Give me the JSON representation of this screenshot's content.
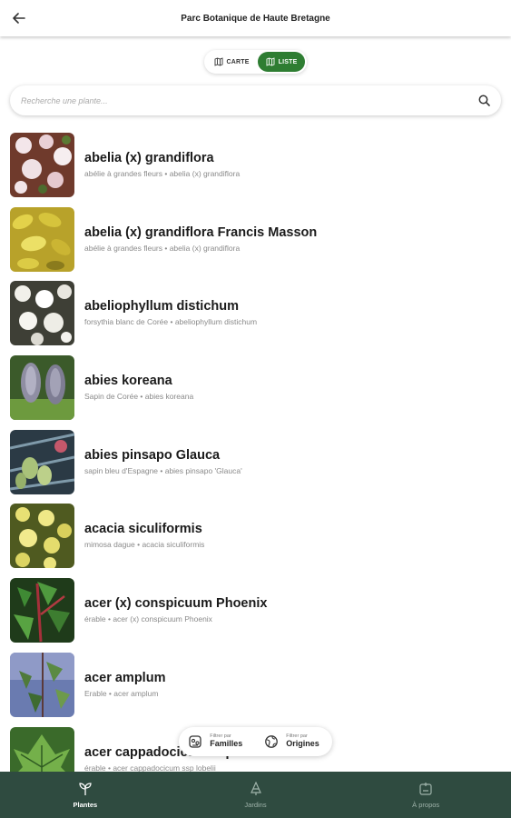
{
  "appbar": {
    "title": "Parc Botanique de Haute Bretagne",
    "back_icon": "arrow-left-icon"
  },
  "view_toggle": {
    "options": [
      {
        "label": "CARTE",
        "icon": "map-icon",
        "active": false
      },
      {
        "label": "LISTE",
        "icon": "list-icon",
        "active": true
      }
    ]
  },
  "search": {
    "placeholder": "Recherche une plante...",
    "value": "",
    "icon": "search-icon"
  },
  "plants": [
    {
      "name": "abelia (x) grandiflora",
      "subtitle": "abélie à grandes fleurs • abelia (x) grandiflora"
    },
    {
      "name": "abelia (x) grandiflora Francis Masson",
      "subtitle": "abélie à grandes fleurs • abelia (x) grandiflora"
    },
    {
      "name": "abeliophyllum distichum",
      "subtitle": "forsythia blanc de Corée • abeliophyllum distichum"
    },
    {
      "name": "abies koreana",
      "subtitle": "Sapin de Corée • abies koreana"
    },
    {
      "name": "abies pinsapo Glauca",
      "subtitle": "sapin bleu d'Espagne • abies pinsapo 'Glauca'"
    },
    {
      "name": "acacia siculiformis",
      "subtitle": "mimosa dague • acacia siculiformis"
    },
    {
      "name": "acer (x) conspicuum Phoenix",
      "subtitle": "érable • acer (x) conspicuum Phoenix"
    },
    {
      "name": "acer amplum",
      "subtitle": "Erable • acer amplum"
    },
    {
      "name": "acer cappadocicum ssp lobelii",
      "subtitle": "érable • acer cappadocicum ssp lobelii"
    }
  ],
  "filters": [
    {
      "small": "Filtrer par",
      "label": "Familles",
      "icon": "families-icon"
    },
    {
      "small": "Filtrer par",
      "label": "Origines",
      "icon": "globe-icon"
    }
  ],
  "bottom_nav": [
    {
      "label": "Plantes",
      "icon": "plant-icon",
      "active": true
    },
    {
      "label": "Jardins",
      "icon": "garden-icon",
      "active": false
    },
    {
      "label": "À propos",
      "icon": "info-icon",
      "active": false
    }
  ],
  "colors": {
    "accent": "#2e7d32",
    "nav_bg": "#2f4b40"
  }
}
